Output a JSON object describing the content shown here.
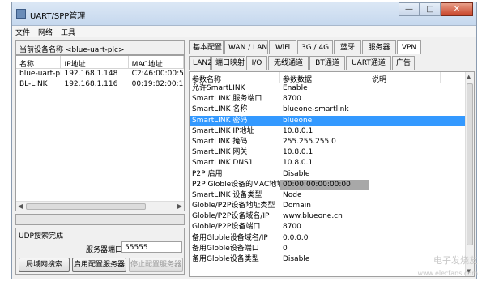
{
  "window": {
    "title": "UART/SPP管理",
    "minimize": "—",
    "maximize": "□",
    "close": "✕"
  },
  "menu": [
    "文件",
    "网络",
    "工具"
  ],
  "device": {
    "current_label": "当前设备名称 <blue-uart-plc>",
    "columns": [
      "名称",
      "IP地址",
      "MAC地址"
    ],
    "rows": [
      [
        "blue-uart-plc",
        "192.168.1.148",
        "C2:46:00:00:5"
      ],
      [
        "BL-LINK",
        "192.168.1.116",
        "00:19:82:00:1"
      ]
    ]
  },
  "udp": {
    "status": "UDP搜索完成",
    "port_label": "服务器端口:",
    "port_value": "55555",
    "buttons": {
      "search": "局域网搜索",
      "start_server": "启用配置服务器",
      "stop_server": "停止配置服务器"
    }
  },
  "tabs_row1": [
    "基本配置",
    "WAN / LAN",
    "WiFi",
    "3G / 4G",
    "蓝牙",
    "服务器",
    "VPN"
  ],
  "tabs_row2": [
    "LAN2",
    "端口映射",
    "I/O",
    "无线通道",
    "BT通道",
    "UART通道",
    "广告"
  ],
  "active_tab": "VPN",
  "params": {
    "columns": [
      "参数名称",
      "参数数据",
      "说明"
    ],
    "rows": [
      [
        "允许SmartLINK",
        "Enable",
        ""
      ],
      [
        "SmartLINK 服务端口",
        "8700",
        ""
      ],
      [
        "SmartLINK 名称",
        "blueone-smartlink",
        ""
      ],
      [
        "SmartLINK 密码",
        "blueone",
        ""
      ],
      [
        "SmartLINK IP地址",
        "10.8.0.1",
        ""
      ],
      [
        "SmartLINK 掩码",
        "255.255.255.0",
        ""
      ],
      [
        "SmartLINK 网关",
        "10.8.0.1",
        ""
      ],
      [
        "SmartLINK DNS1",
        "10.8.0.1",
        ""
      ],
      [
        "P2P 启用",
        "Disable",
        ""
      ],
      [
        "P2P Globle设备的MAC地址",
        "00:00:00:00:00:00",
        ""
      ],
      [
        "SmartLINK 设备类型",
        "Node",
        ""
      ],
      [
        "Globle/P2P设备地址类型",
        "Domain",
        ""
      ],
      [
        "Globle/P2P设备域名/IP",
        "www.blueone.cn",
        ""
      ],
      [
        "Globle/P2P设备端口",
        "8700",
        ""
      ],
      [
        "备用Globle设备域名/IP",
        "0.0.0.0",
        ""
      ],
      [
        "备用Globle设备端口",
        "0",
        ""
      ],
      [
        "备用Globle设备类型",
        "Disable",
        ""
      ]
    ],
    "selected_row": 3,
    "gray_cell_row": 9
  },
  "watermark": {
    "text": "电子发烧友",
    "url": "www.elecfans.com"
  }
}
